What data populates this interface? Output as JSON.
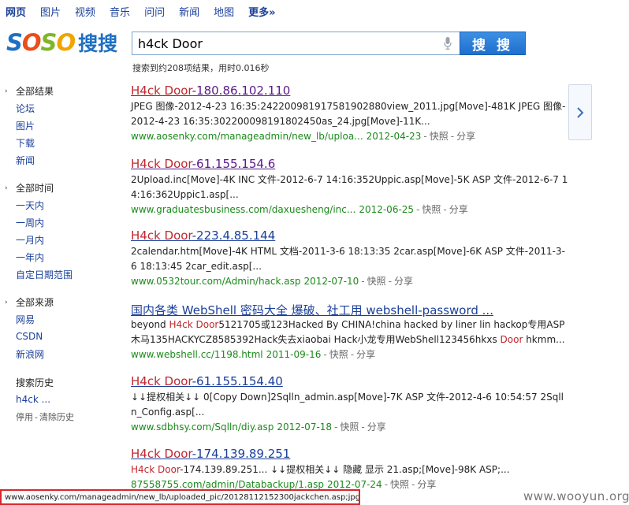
{
  "topnav": {
    "items": [
      "网页",
      "图片",
      "视频",
      "音乐",
      "问问",
      "新闻",
      "地图",
      "更多»"
    ]
  },
  "logo": {
    "soso": [
      "S",
      "O",
      "S",
      "O"
    ],
    "cn": "搜搜"
  },
  "search": {
    "query": "h4ck Door",
    "button_label": "搜 搜"
  },
  "result_stats": "搜索到约208项结果，用时0.016秒",
  "sidebar": {
    "group_results": {
      "head": "全部结果",
      "items": [
        "论坛",
        "图片",
        "下载",
        "新闻"
      ]
    },
    "group_time": {
      "head": "全部时间",
      "items": [
        "一天内",
        "一周内",
        "一月内",
        "一年内",
        "自定日期范围"
      ]
    },
    "group_source": {
      "head": "全部来源",
      "items": [
        "网易",
        "CSDN",
        "新浪网"
      ]
    },
    "history": {
      "head": "搜索历史",
      "item": "h4ck ...",
      "disable": "停用",
      "dash": "-",
      "clear": "清除历史"
    }
  },
  "results": [
    {
      "title_hl": "H4ck Door",
      "title_rest": "-180.86.102.110",
      "snippet": "JPEG 图像-2012-4-23 16:35:24220098191758190288​0view_2011.jpg[Move]-481K JPEG 图像-2012-4-23 16:35:30220009819180245​0as_24.jpg[Move]-11K...",
      "url": "www.aosenky.com/manageadmin/new_lb/uploa...",
      "date": "2012-04-23",
      "cache": "快照",
      "share": "分享"
    },
    {
      "title_hl": "H4ck Door",
      "title_rest": "-61.155.154.6",
      "snippet": "2Upload.inc[Move]-4K INC 文件-2012-6-7 14:16:352Uppic.asp[Move]-5K ASP 文件-2012-6-7 14:16:362Uppic1.asp[...",
      "url": "www.graduatesbusiness.com/daxuesheng/inc...",
      "date": "2012-06-25",
      "cache": "快照",
      "share": "分享"
    },
    {
      "title_hl": "H4ck Door",
      "title_rest": "-223.4.85.144",
      "snippet": "2calendar.htm[Move]-4K HTML 文档-2011-3-6 18:13:35 2car.asp[Move]-6K ASP 文件-2011-3-6 18:13:45 2car_edit.asp[...",
      "url": "www.0532tour.com/Admin/hack.asp",
      "date": "2012-07-10",
      "cache": "快照",
      "share": "分享"
    },
    {
      "title_plain": "国内各类 WebShell 密码大全 爆破、社工用 webshell-password ...",
      "snippet_a": "beyond ",
      "snippet_hl1": "H4ck Door",
      "snippet_b": "5121705或123Hacked By CHINA!china hacked by liner lin hackop专用ASP木马135HACKYCZ8585392Hack失去xiaobai Hack小龙专用WebShell123456hkxs ",
      "snippet_hl2": "Door",
      "snippet_c": " hkmm...",
      "url": "www.webshell.cc/1198.html",
      "date": "2011-09-16",
      "cache": "快照",
      "share": "分享"
    },
    {
      "title_hl": "H4ck Door",
      "title_rest": "-61.155.154.40",
      "snippet": "↓↓提权相关↓↓ 0[Copy Down]2Sqlln_admin.asp[Move]-7K ASP 文件-2012-4-6 10:54:57 2Sqlln_Config.asp[...",
      "url": "www.sdbhsy.com/Sqlln/diy.asp",
      "date": "2012-07-18",
      "cache": "快照",
      "share": "分享"
    },
    {
      "title_hl": "H4ck Door",
      "title_rest": "-174.139.89.251",
      "snippet_hl": "H4ck Door",
      "snippet_rest": "-174.139.89.251... ↓↓提权相关↓↓ 隐藏 显示 21.asp;[Move]-98K ASP;...",
      "url": "87558755.com/admin/Databackup/1.asp",
      "date": "2012-07-24",
      "cache": "快照",
      "share": "分享"
    }
  ],
  "statusbar": "www.aosenky.com/manageadmin/new_lb/uploaded_pic/20128112152300jackchen.asp;jpg",
  "watermark": "www.wooyun.org",
  "sep": "-"
}
